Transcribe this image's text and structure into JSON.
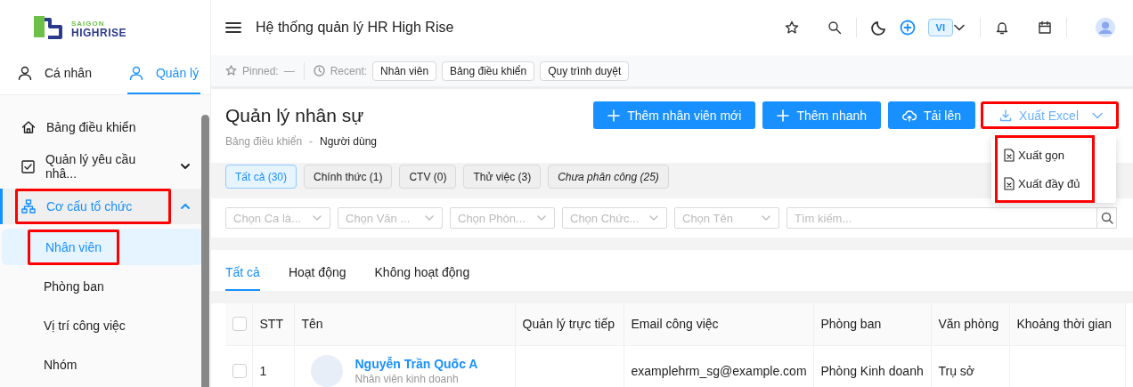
{
  "logo": {
    "line1": "SAIGON",
    "line2": "HIGHRISE"
  },
  "sidebar": {
    "tabs": [
      {
        "label": "Cá nhân",
        "selected": false
      },
      {
        "label": "Quản lý",
        "selected": true
      }
    ],
    "items": [
      {
        "kind": "link",
        "label": "Bảng điều khiển",
        "selected": false,
        "highlighted": false
      },
      {
        "kind": "group",
        "label": "Quản lý yêu cầu nhâ...",
        "selected": false,
        "expanded": false,
        "highlighted": false
      },
      {
        "kind": "group",
        "label": "Cơ cấu tổ chức",
        "selected": true,
        "expanded": true,
        "highlighted": true,
        "children": [
          {
            "label": "Nhân viên",
            "selected": true,
            "highlighted": true
          },
          {
            "label": "Phòng ban",
            "selected": false,
            "highlighted": false
          },
          {
            "label": "Vị trí công việc",
            "selected": false,
            "highlighted": false
          },
          {
            "label": "Nhóm",
            "selected": false,
            "highlighted": false
          }
        ]
      }
    ]
  },
  "header": {
    "title": "Hệ thống quản lý HR High Rise",
    "language": "VI"
  },
  "recent_bar": {
    "pinned_label": "Pinned:",
    "pinned_value": "—",
    "recent_label": "Recent:",
    "recent": [
      "Nhân viên",
      "Bảng điều khiển",
      "Quy trình duyệt"
    ]
  },
  "page": {
    "title": "Quản lý nhân sự",
    "breadcrumb": [
      "Bảng điều khiển",
      "Người dùng"
    ],
    "breadcrumb_separator": "-",
    "actions": [
      {
        "kind": "primary",
        "label": "Thêm nhân viên mới",
        "highlighted": false
      },
      {
        "kind": "primary",
        "label": "Thêm nhanh",
        "highlighted": false
      },
      {
        "kind": "primary",
        "label": "Tải lên",
        "highlighted": false
      },
      {
        "kind": "outline",
        "label": "Xuất Excel",
        "highlighted": true
      }
    ],
    "export_menu": {
      "highlighted": true,
      "items": [
        "Xuất gọn",
        "Xuất đầy đủ"
      ]
    }
  },
  "status_filters": [
    {
      "label": "Tất cả (30)",
      "selected": true,
      "italic": false
    },
    {
      "label": "Chính thức (1)",
      "selected": false,
      "italic": false
    },
    {
      "label": "CTV (0)",
      "selected": false,
      "italic": false
    },
    {
      "label": "Thử việc (3)",
      "selected": false,
      "italic": false
    },
    {
      "label": "Chưa phân công (25)",
      "selected": false,
      "italic": true
    }
  ],
  "filters": {
    "selects": [
      {
        "placeholder": "Chọn Ca là..."
      },
      {
        "placeholder": "Chọn Văn ..."
      },
      {
        "placeholder": "Chọn Phòn..."
      },
      {
        "placeholder": "Chọn Chức..."
      },
      {
        "placeholder": "Chọn Tên"
      }
    ],
    "search": {
      "placeholder": "Tìm kiếm..."
    }
  },
  "view_tabs": [
    {
      "label": "Tất cả",
      "selected": true
    },
    {
      "label": "Hoạt động",
      "selected": false
    },
    {
      "label": "Không hoạt động",
      "selected": false
    }
  ],
  "table": {
    "select_all_checked": false,
    "columns": [
      "STT",
      "Tên",
      "Quản lý trực tiếp",
      "Email công việc",
      "Phòng ban",
      "Văn phòng",
      "Khoảng thời gian"
    ],
    "rows": [
      {
        "checked": false,
        "stt": "1",
        "name": "Nguyễn Trần Quốc A",
        "position": "Nhân viên kinh doanh",
        "email": "examplehrm_sg@example.com",
        "department": "Phòng Kinh doanh",
        "office": "Trụ sở"
      }
    ]
  }
}
